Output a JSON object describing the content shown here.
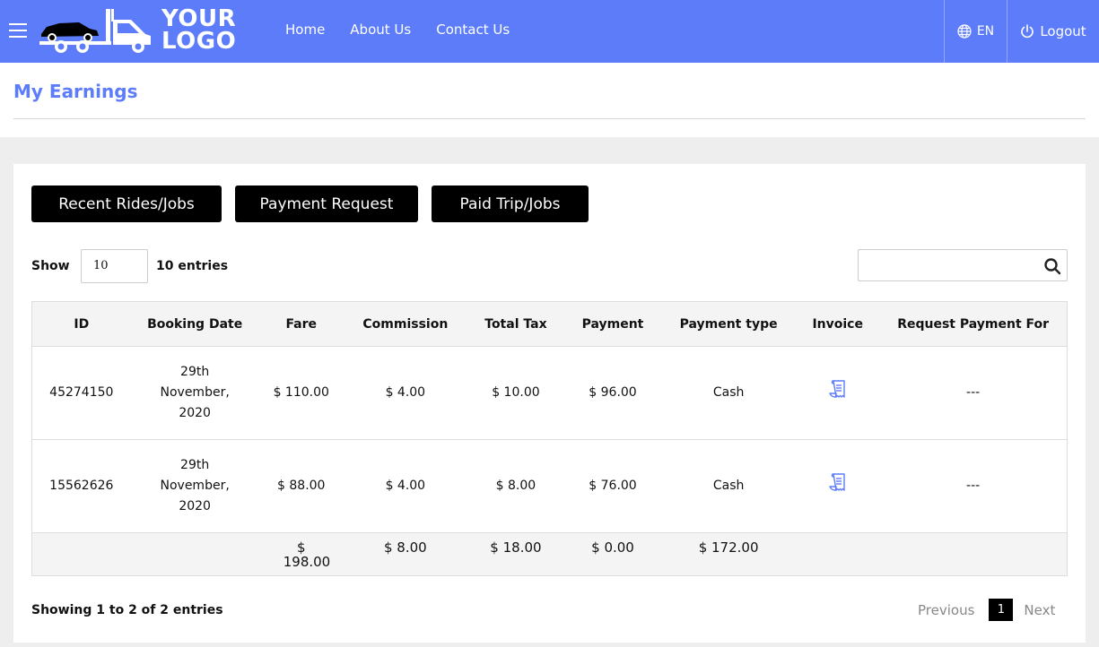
{
  "header": {
    "logo_line1": "YOUR",
    "logo_line2": "LOGO",
    "nav": [
      "Home",
      "About Us",
      "Contact Us"
    ],
    "language": "EN",
    "logout": "Logout",
    "brand_color": "#5c7cfa"
  },
  "page": {
    "title": "My Earnings"
  },
  "tabs": [
    "Recent Rides/Jobs",
    "Payment Request",
    "Paid Trip/Jobs"
  ],
  "controls": {
    "show_label": "Show",
    "entries_value": "10",
    "entries_label": "10 entries",
    "search_value": ""
  },
  "table": {
    "headers": [
      "ID",
      "Booking Date",
      "Fare",
      "Commission",
      "Total Tax",
      "Payment",
      "Payment type",
      "Invoice",
      "Request Payment For"
    ],
    "rows": [
      {
        "id": "45274150",
        "date": "29th November, 2020",
        "fare": "$ 110.00",
        "commission": "$ 4.00",
        "tax": "$ 10.00",
        "payment": "$ 96.00",
        "payment_type": "Cash",
        "invoice_icon": "receipt-icon",
        "request_for": "---"
      },
      {
        "id": "15562626",
        "date": "29th November, 2020",
        "fare": "$ 88.00",
        "commission": "$ 4.00",
        "tax": "$ 8.00",
        "payment": "$ 76.00",
        "payment_type": "Cash",
        "invoice_icon": "receipt-icon",
        "request_for": "---"
      }
    ],
    "totals": {
      "fare": "$ 198.00",
      "commission": "$ 8.00",
      "tax": "$ 18.00",
      "payment": "$ 0.00",
      "payment_type": "$ 172.00"
    }
  },
  "footer": {
    "showing": "Showing 1 to 2 of 2 entries",
    "previous": "Previous",
    "page": "1",
    "next": "Next"
  }
}
